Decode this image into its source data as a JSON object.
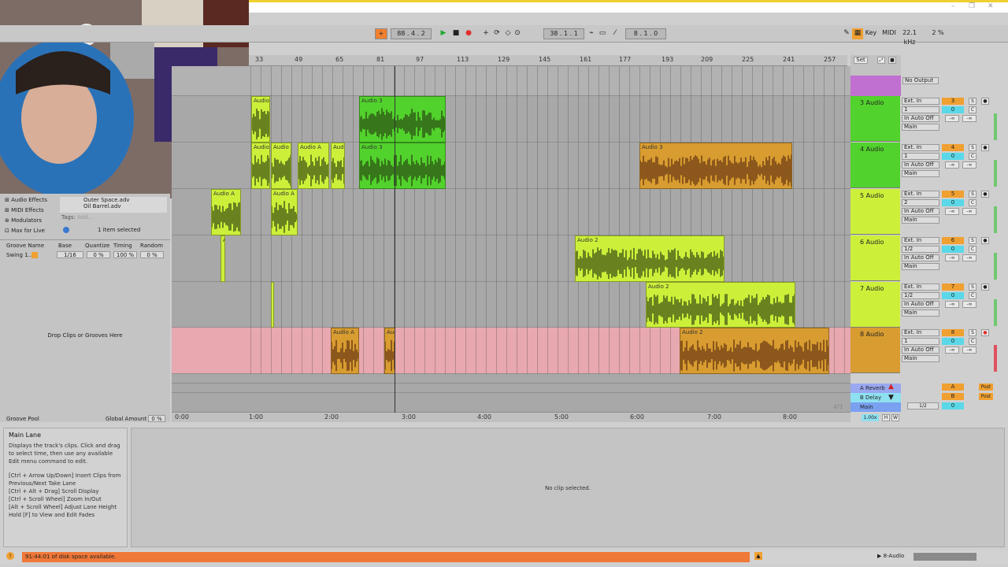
{
  "transport": {
    "tempo_sig": "88 . 4 . 2",
    "position": "38 . 1 . 1",
    "loop_len": "8 . 1 . 0",
    "key": "Key",
    "midi": "MIDI",
    "sample_rate": "22.1 kHz",
    "cpu": "2 %"
  },
  "ruler": {
    "bars": [
      "33",
      "49",
      "65",
      "81",
      "97",
      "113",
      "129",
      "145",
      "161",
      "177",
      "193",
      "209",
      "225",
      "241",
      "257"
    ],
    "set_label": "Set"
  },
  "timeline": {
    "times": [
      "0:00",
      "1:00",
      "2:00",
      "3:00",
      "4:00",
      "5:00",
      "6:00",
      "7:00",
      "8:00"
    ]
  },
  "tracks": [
    {
      "name": "3 Audio",
      "color": "#52d22c",
      "input": "Ext. In",
      "chan": "1",
      "num": "3",
      "out": "Main"
    },
    {
      "name": "4 Audio",
      "color": "#52d22c",
      "input": "Ext. In",
      "chan": "1",
      "num": "4",
      "out": "Main"
    },
    {
      "name": "5 Audio",
      "color": "#ccf03a",
      "input": "Ext. In",
      "chan": "2",
      "num": "5",
      "out": "Main"
    },
    {
      "name": "6 Audio",
      "color": "#ccf03a",
      "input": "Ext. In",
      "chan": "1/2",
      "num": "6",
      "out": "Main"
    },
    {
      "name": "7 Audio",
      "color": "#ccf03a",
      "input": "Ext. In",
      "chan": "1/2",
      "num": "7",
      "out": "Main"
    },
    {
      "name": "8 Audio",
      "color": "#d89c30",
      "input": "Ext. In",
      "chan": "1",
      "num": "8",
      "out": "Main"
    }
  ],
  "io_labels": {
    "in": "In",
    "auto": "Auto",
    "off": "Off",
    "minus_inf": "-∞",
    "c": "C",
    "s": "S",
    "zero": "0"
  },
  "clips": {
    "audio3": "Audio 3",
    "audio2": "Audio 2",
    "audio_a": "Audio A",
    "audio": "Audio"
  },
  "returns": [
    {
      "label": "A Reverb",
      "tag": "A",
      "color": "#9aa8f0"
    },
    {
      "label": "B Delay",
      "tag": "B",
      "color": "#8ee0f0"
    },
    {
      "label": "Main",
      "tag": "0",
      "color": "#7aa0f0"
    }
  ],
  "return_extra": {
    "post": "Post",
    "master_pos": "1/2",
    "sig": "4/1",
    "zoom": "1.00x",
    "h": "H",
    "w": "W",
    "no_output": "No Output"
  },
  "browser": {
    "items": [
      "Audio Effects",
      "MIDI Effects",
      "Modulators",
      "Max for Live"
    ],
    "files": [
      "Outer Space.adv",
      "Oil Barrel.adv"
    ],
    "tags_label": "Tags:",
    "tags_add": "Add...",
    "selected": "1 item selected",
    "groove_headers": [
      "Groove Name",
      "Base",
      "Quantize",
      "Timing",
      "Random"
    ],
    "groove_row": {
      "name": "Swing 1...",
      "base": "1/16",
      "quantize": "0 %",
      "timing": "100 %",
      "random": "0 %"
    },
    "drop_text": "Drop Clips or Grooves Here",
    "groove_pool": "Groove Pool",
    "global_amount": "Global Amount",
    "global_value": "0 %"
  },
  "info": {
    "title": "Main Lane",
    "body": "Displays the track's clips. Click and drag to select time, then use any available Edit menu command to edit.",
    "shortcuts": [
      "[Ctrl + Arrow Up/Down] Insert Clips from Previous/Next Take Lane",
      "[Ctrl + Alt + Drag] Scroll Display",
      "[Ctrl + Scroll Wheel] Zoom In/Out",
      "[Alt + Scroll Wheel] Adjust Lane Height",
      "Hold [F] to View and Edit Fades"
    ]
  },
  "clipview": {
    "empty": "No clip selected."
  },
  "status": {
    "warning": "91:44:01 of disk space available.",
    "track": "8-Audio"
  }
}
